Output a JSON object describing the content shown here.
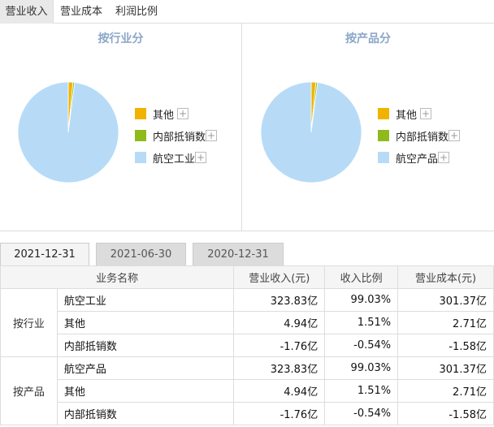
{
  "top_tabs": [
    "营业收入",
    "营业成本",
    "利润比例"
  ],
  "chart_data": [
    {
      "type": "pie",
      "title": "按行业分",
      "slices": [
        {
          "label": "其他",
          "value": 1.51,
          "color": "#f0b400"
        },
        {
          "label": "内部抵销数",
          "value": 0.54,
          "color": "#8fba1c"
        },
        {
          "label": "航空工业",
          "value": 99.03,
          "color": "#b7dbf7"
        }
      ]
    },
    {
      "type": "pie",
      "title": "按产品分",
      "slices": [
        {
          "label": "其他",
          "value": 1.51,
          "color": "#f0b400"
        },
        {
          "label": "内部抵销数",
          "value": 0.54,
          "color": "#8fba1c"
        },
        {
          "label": "航空产品",
          "value": 99.03,
          "color": "#b7dbf7"
        }
      ]
    }
  ],
  "legend_plus": "+",
  "date_tabs": [
    "2021-12-31",
    "2021-06-30",
    "2020-12-31"
  ],
  "table": {
    "headers": [
      "业务名称",
      "营业收入(元)",
      "收入比例",
      "营业成本(元)"
    ],
    "groups": [
      {
        "label": "按行业",
        "rows": [
          [
            "航空工业",
            "323.83亿",
            "99.03%",
            "301.37亿"
          ],
          [
            "其他",
            "4.94亿",
            "1.51%",
            "2.71亿"
          ],
          [
            "内部抵销数",
            "-1.76亿",
            "-0.54%",
            "-1.58亿"
          ]
        ]
      },
      {
        "label": "按产品",
        "rows": [
          [
            "航空产品",
            "323.83亿",
            "99.03%",
            "301.37亿"
          ],
          [
            "其他",
            "4.94亿",
            "1.51%",
            "2.71亿"
          ],
          [
            "内部抵销数",
            "-1.76亿",
            "-0.54%",
            "-1.58亿"
          ]
        ]
      }
    ]
  }
}
